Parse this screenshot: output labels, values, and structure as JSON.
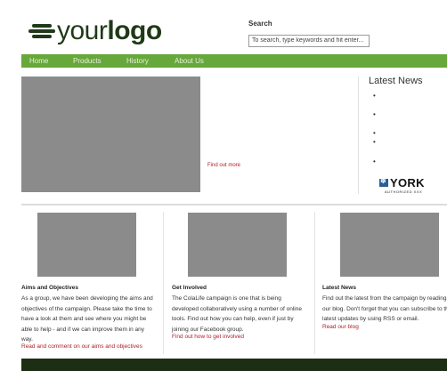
{
  "logo": {
    "text_light": "your",
    "text_bold": "logo"
  },
  "search": {
    "label": "Search",
    "placeholder": "To search, type keywords and hit enter..."
  },
  "nav": [
    "Home",
    "Products",
    "History",
    "About Us"
  ],
  "hero": {
    "link": "Find out more"
  },
  "news": {
    "title": "Latest News",
    "bullet": "•"
  },
  "sponsor": {
    "name": "YORK",
    "sub": "AUTHORIZED XXX"
  },
  "columns": [
    {
      "title": "Aims and Objectives",
      "lines": [
        "As a group, we have been developing the aims and",
        "objectives of the campaign. Please take the time to",
        "have a look at them and see where you might be",
        "able to help - and if we can improve them in any",
        "way."
      ],
      "link": "Read and comment on our aims and objectives"
    },
    {
      "title": "Get Involved",
      "lines": [
        "The ColaLife campaign is one that is being",
        "developed collaboratively using a number of online",
        "tools. Find out how you can help, even if just by",
        "joining our Facebook group."
      ],
      "link": "Find out how to get involved"
    },
    {
      "title": "Latest News",
      "lines": [
        "Find out the latest from the campaign by reading",
        "our blog. Don't forget that you can subscribe to the",
        "latest updates by using RSS or email."
      ],
      "link": "Read our blog"
    }
  ],
  "colors": {
    "nav_green": "#66a83a",
    "logo_dark": "#1f3a16",
    "link_red": "#b0202a",
    "footer_dark": "#1c2e14"
  }
}
